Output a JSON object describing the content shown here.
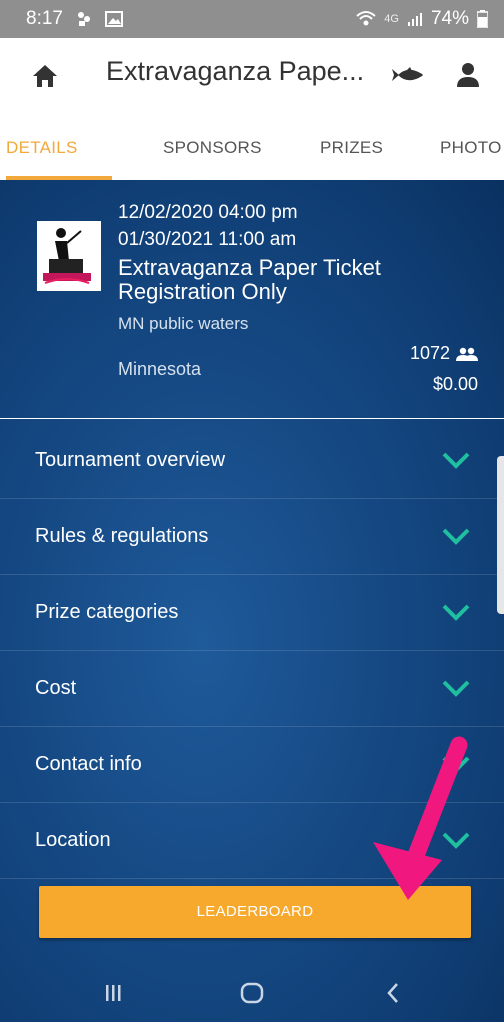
{
  "status_bar": {
    "time": "8:17",
    "network": "4G",
    "battery": "74%"
  },
  "app_bar": {
    "title": "Extravaganza Pape..."
  },
  "tabs": [
    {
      "label": "DETAILS",
      "active": true
    },
    {
      "label": "SPONSORS",
      "active": false
    },
    {
      "label": "PRIZES",
      "active": false
    },
    {
      "label": "PHOTO",
      "active": false
    }
  ],
  "event": {
    "start": "12/02/2020 04:00 pm",
    "end": "01/30/2021 11:00 am",
    "title": "Extravaganza Paper Ticket Registration Only",
    "waters": "MN public waters",
    "state": "Minnesota",
    "participants": "1072",
    "price": "$0.00"
  },
  "accordion": [
    {
      "label": "Tournament overview"
    },
    {
      "label": "Rules & regulations"
    },
    {
      "label": "Prize categories"
    },
    {
      "label": "Cost"
    },
    {
      "label": "Contact info"
    },
    {
      "label": "Location"
    }
  ],
  "leaderboard_label": "LEADERBOARD",
  "colors": {
    "accent": "#f2a83b",
    "chevron": "#1fbf9f",
    "annotation_arrow": "#f0187f"
  },
  "icons": {
    "home": "home-icon",
    "fish": "fish-icon",
    "profile": "person-icon",
    "participants": "people-icon",
    "chevron": "chevron-down-icon"
  }
}
